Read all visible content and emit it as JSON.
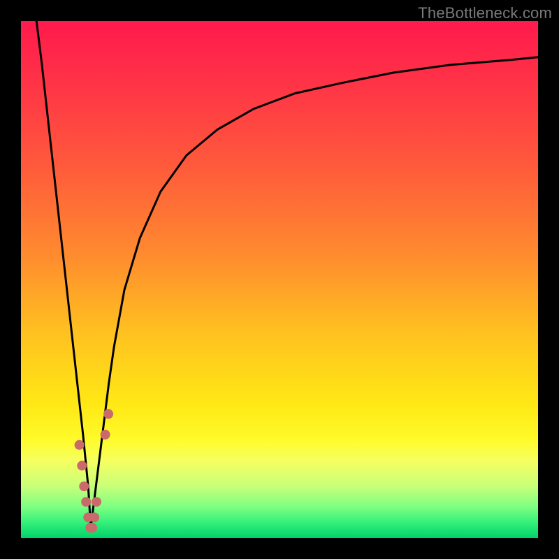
{
  "watermark": "TheBottleneck.com",
  "colors": {
    "frame": "#000000",
    "curve": "#000000",
    "marker": "#cb6a6a",
    "gradient_stops": [
      {
        "pct": 0,
        "color": "#ff1a4c"
      },
      {
        "pct": 12,
        "color": "#ff3347"
      },
      {
        "pct": 28,
        "color": "#ff5a3b"
      },
      {
        "pct": 45,
        "color": "#ff8a2f"
      },
      {
        "pct": 60,
        "color": "#ffc020"
      },
      {
        "pct": 74,
        "color": "#ffe815"
      },
      {
        "pct": 81,
        "color": "#fffb2a"
      },
      {
        "pct": 85,
        "color": "#f6ff60"
      },
      {
        "pct": 90,
        "color": "#c8ff78"
      },
      {
        "pct": 94,
        "color": "#7dff82"
      },
      {
        "pct": 97,
        "color": "#34f07a"
      },
      {
        "pct": 100,
        "color": "#00d26a"
      }
    ]
  },
  "chart_data": {
    "type": "line",
    "title": "",
    "xlabel": "",
    "ylabel": "",
    "xlim": [
      0,
      100
    ],
    "ylim": [
      0,
      100
    ],
    "series": [
      {
        "name": "left-branch",
        "x": [
          3,
          4,
          5,
          6,
          7,
          8,
          9,
          10,
          11,
          12,
          13,
          13.5
        ],
        "y": [
          100,
          92,
          83,
          74,
          65,
          56,
          47,
          38,
          29,
          20,
          10,
          2
        ]
      },
      {
        "name": "right-branch",
        "x": [
          13.5,
          14,
          15,
          16,
          17,
          18,
          20,
          23,
          27,
          32,
          38,
          45,
          53,
          62,
          72,
          83,
          95,
          100
        ],
        "y": [
          2,
          6,
          14,
          22,
          30,
          37,
          48,
          58,
          67,
          74,
          79,
          83,
          86,
          88,
          90,
          91.5,
          92.5,
          93
        ]
      }
    ],
    "markers": [
      {
        "x": 11.3,
        "y": 18
      },
      {
        "x": 11.8,
        "y": 14
      },
      {
        "x": 12.2,
        "y": 10
      },
      {
        "x": 12.6,
        "y": 7
      },
      {
        "x": 13.0,
        "y": 4
      },
      {
        "x": 13.4,
        "y": 2
      },
      {
        "x": 13.8,
        "y": 2
      },
      {
        "x": 14.2,
        "y": 4
      },
      {
        "x": 14.6,
        "y": 7
      },
      {
        "x": 16.3,
        "y": 20
      },
      {
        "x": 16.9,
        "y": 24
      }
    ],
    "marker_radius": 7,
    "curve_width": 3
  }
}
